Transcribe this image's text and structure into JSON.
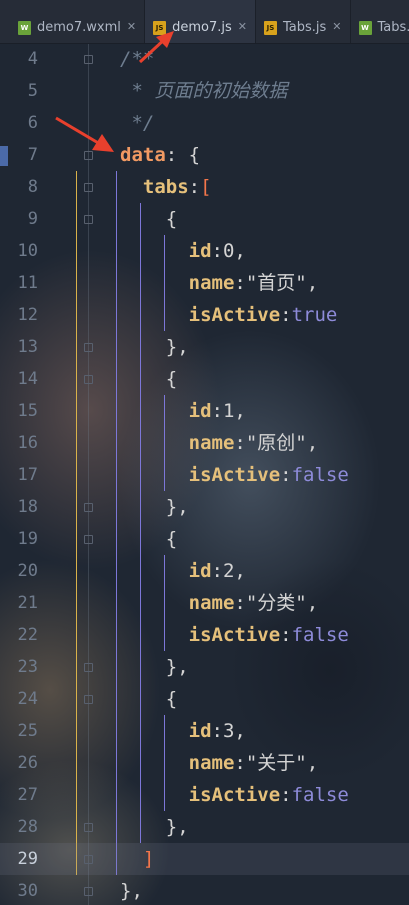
{
  "tabs": [
    {
      "label": "demo7.wxml",
      "icon": "wxml-file-icon",
      "closable": true
    },
    {
      "label": "demo7.js",
      "icon": "js-file-icon",
      "closable": true,
      "active": true
    },
    {
      "label": "Tabs.js",
      "icon": "js-file-icon",
      "closable": true
    },
    {
      "label": "Tabs.wxm",
      "icon": "wxml-file-icon",
      "closable": false
    }
  ],
  "editor": {
    "current_line": 29,
    "lines": [
      {
        "n": "4",
        "tokens": [
          {
            "t": "/**",
            "k": "comment"
          }
        ]
      },
      {
        "n": "5",
        "tokens": [
          {
            "t": " * 页面的初始数据",
            "k": "comment"
          }
        ]
      },
      {
        "n": "6",
        "tokens": [
          {
            "t": " */",
            "k": "comment"
          }
        ]
      },
      {
        "n": "7",
        "tokens": [
          {
            "t": "data",
            "k": "key"
          },
          {
            "t": ": {",
            "k": "punct"
          }
        ]
      },
      {
        "n": "8",
        "tokens": [
          {
            "t": "  tabs",
            "k": "prop"
          },
          {
            "t": ":",
            "k": "punct"
          },
          {
            "t": "[",
            "k": "bracket-o"
          }
        ]
      },
      {
        "n": "9",
        "tokens": [
          {
            "t": "    {",
            "k": "punct"
          }
        ]
      },
      {
        "n": "10",
        "tokens": [
          {
            "t": "      id",
            "k": "prop"
          },
          {
            "t": ":0,",
            "k": "punct"
          }
        ]
      },
      {
        "n": "11",
        "tokens": [
          {
            "t": "      name",
            "k": "prop"
          },
          {
            "t": ":\"首页\",",
            "k": "str"
          }
        ]
      },
      {
        "n": "12",
        "tokens": [
          {
            "t": "      isActive",
            "k": "prop"
          },
          {
            "t": ":",
            "k": "punct"
          },
          {
            "t": "true",
            "k": "bool"
          }
        ]
      },
      {
        "n": "13",
        "tokens": [
          {
            "t": "    },",
            "k": "punct"
          }
        ]
      },
      {
        "n": "14",
        "tokens": [
          {
            "t": "    {",
            "k": "punct"
          }
        ]
      },
      {
        "n": "15",
        "tokens": [
          {
            "t": "      id",
            "k": "prop"
          },
          {
            "t": ":1,",
            "k": "punct"
          }
        ]
      },
      {
        "n": "16",
        "tokens": [
          {
            "t": "      name",
            "k": "prop"
          },
          {
            "t": ":\"原创\",",
            "k": "str"
          }
        ]
      },
      {
        "n": "17",
        "tokens": [
          {
            "t": "      isActive",
            "k": "prop"
          },
          {
            "t": ":",
            "k": "punct"
          },
          {
            "t": "false",
            "k": "bool"
          }
        ]
      },
      {
        "n": "18",
        "tokens": [
          {
            "t": "    },",
            "k": "punct"
          }
        ]
      },
      {
        "n": "19",
        "tokens": [
          {
            "t": "    {",
            "k": "punct"
          }
        ]
      },
      {
        "n": "20",
        "tokens": [
          {
            "t": "      id",
            "k": "prop"
          },
          {
            "t": ":2,",
            "k": "punct"
          }
        ]
      },
      {
        "n": "21",
        "tokens": [
          {
            "t": "      name",
            "k": "prop"
          },
          {
            "t": ":\"分类\",",
            "k": "str"
          }
        ]
      },
      {
        "n": "22",
        "tokens": [
          {
            "t": "      isActive",
            "k": "prop"
          },
          {
            "t": ":",
            "k": "punct"
          },
          {
            "t": "false",
            "k": "bool"
          }
        ]
      },
      {
        "n": "23",
        "tokens": [
          {
            "t": "    },",
            "k": "punct"
          }
        ]
      },
      {
        "n": "24",
        "tokens": [
          {
            "t": "    {",
            "k": "punct"
          }
        ]
      },
      {
        "n": "25",
        "tokens": [
          {
            "t": "      id",
            "k": "prop"
          },
          {
            "t": ":3,",
            "k": "punct"
          }
        ]
      },
      {
        "n": "26",
        "tokens": [
          {
            "t": "      name",
            "k": "prop"
          },
          {
            "t": ":\"关于\",",
            "k": "str"
          }
        ]
      },
      {
        "n": "27",
        "tokens": [
          {
            "t": "      isActive",
            "k": "prop"
          },
          {
            "t": ":",
            "k": "punct"
          },
          {
            "t": "false",
            "k": "bool"
          }
        ]
      },
      {
        "n": "28",
        "tokens": [
          {
            "t": "    },",
            "k": "punct"
          }
        ]
      },
      {
        "n": "29",
        "tokens": [
          {
            "t": "  ]",
            "k": "bracket-o"
          }
        ]
      },
      {
        "n": "30",
        "tokens": [
          {
            "t": "},",
            "k": "punct"
          }
        ]
      }
    ]
  },
  "annotations": [
    {
      "name": "red-arrow-to-active-tab",
      "color": "#e8402d"
    },
    {
      "name": "red-arrow-to-data",
      "color": "#e8402d"
    }
  ],
  "colors": {
    "background": "#1f2733",
    "keyword": "#f19a63",
    "property": "#e5c07b",
    "boolean": "#8e8bd9",
    "comment": "#6e7d8f",
    "arrow": "#e8402d"
  }
}
